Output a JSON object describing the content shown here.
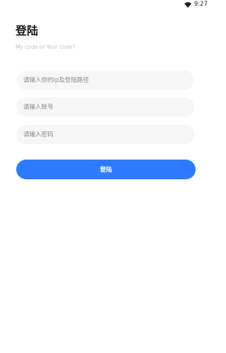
{
  "status_bar": {
    "time": "9:27",
    "icons": [
      "wifi-icon"
    ]
  },
  "page": {
    "title": "登陆",
    "subtitle": "My code or Your code?"
  },
  "form": {
    "ip_path_placeholder": "请输入你的ip及登陆路径",
    "ip_path_value": "",
    "account_placeholder": "请输入账号",
    "account_value": "",
    "password_placeholder": "请输入密码",
    "password_value": ""
  },
  "actions": {
    "login_label": "登陆"
  },
  "colors": {
    "primary": "#2f7bff",
    "field_bg": "#f6f6f6",
    "title_text": "#1a1a1a",
    "subtitle_text": "#c4c4c4"
  }
}
